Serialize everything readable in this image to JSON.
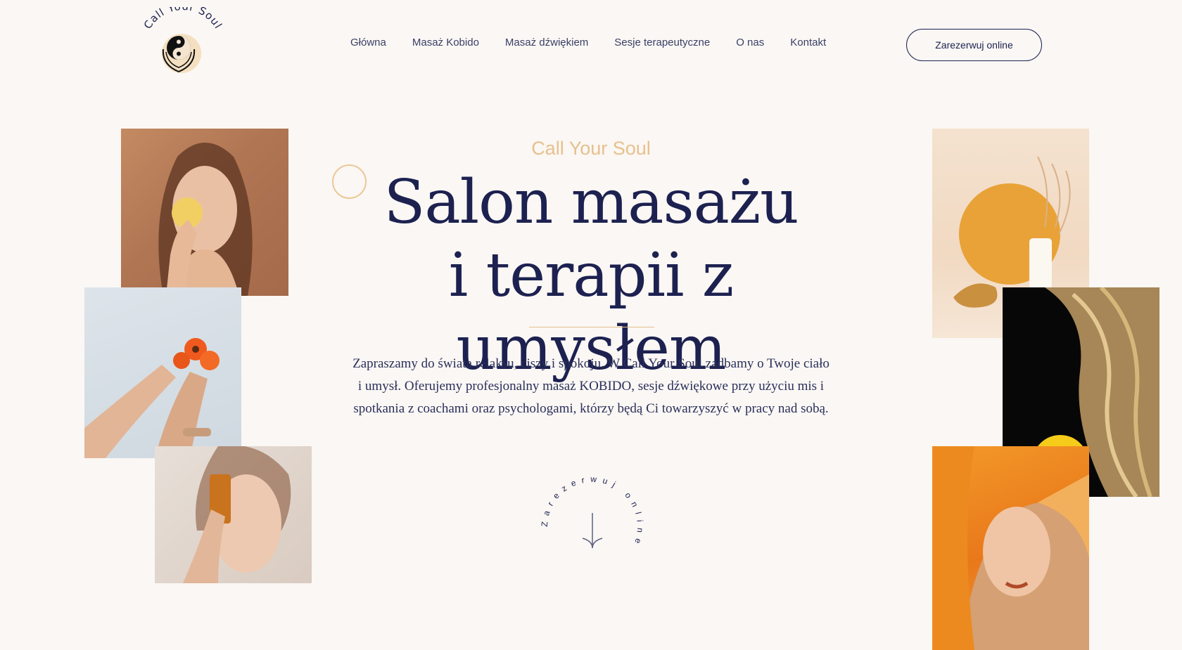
{
  "brand": {
    "logo_text": "Call Your Soul"
  },
  "nav": {
    "items": [
      {
        "label": "Główna"
      },
      {
        "label": "Masaż Kobido"
      },
      {
        "label": "Masaż dźwiękiem"
      },
      {
        "label": "Sesje terapeutyczne"
      },
      {
        "label": "O nas"
      },
      {
        "label": "Kontakt"
      }
    ],
    "cta_label": "Zarezerwuj online"
  },
  "hero": {
    "eyebrow": "Call Your Soul",
    "headline_line1": "Salon masażu",
    "headline_line2": "i terapii z umysłem",
    "intro": "Zapraszamy do świata relaksu, ciszy i spokoju. W Call Your Soul zadbamy o Twoje ciało i umysł. Oferujemy profesjonalny masaż KOBIDO, sesje dźwiękowe przy użyciu mis i spotkania z coachami oraz psychologami, którzy będą Ci towarzyszyć w pracy nad sobą.",
    "circle_cta_text": "Zarezerwuj online"
  },
  "colors": {
    "background": "#faf7f4",
    "navy": "#1c2150",
    "gold": "#e8c08d"
  },
  "icons": {
    "logo": "yin-yang-hands-icon",
    "scroll": "arrow-down-icon"
  }
}
